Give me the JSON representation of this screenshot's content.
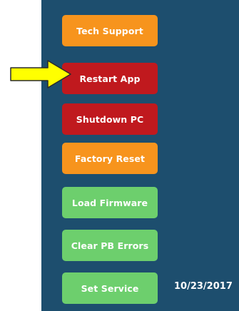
{
  "menu": {
    "buttons": [
      {
        "label": "Tech Support",
        "color": "#f7941d"
      },
      {
        "label": "Restart App",
        "color": "#c0191e"
      },
      {
        "label": "Shutdown PC",
        "color": "#c0191e"
      },
      {
        "label": "Factory Reset",
        "color": "#f7941d"
      },
      {
        "label": "Load Firmware",
        "color": "#6dcf6d"
      },
      {
        "label": "Clear PB Errors",
        "color": "#6dcf6d"
      },
      {
        "label": "Set Service",
        "color": "#6dcf6d"
      }
    ]
  },
  "service_date": "10/23/2017",
  "annotation": {
    "icon": "arrow-right-icon",
    "color": "#ffff00",
    "points_to": "Restart App"
  },
  "colors": {
    "panel_background": "#1d4e6e"
  }
}
